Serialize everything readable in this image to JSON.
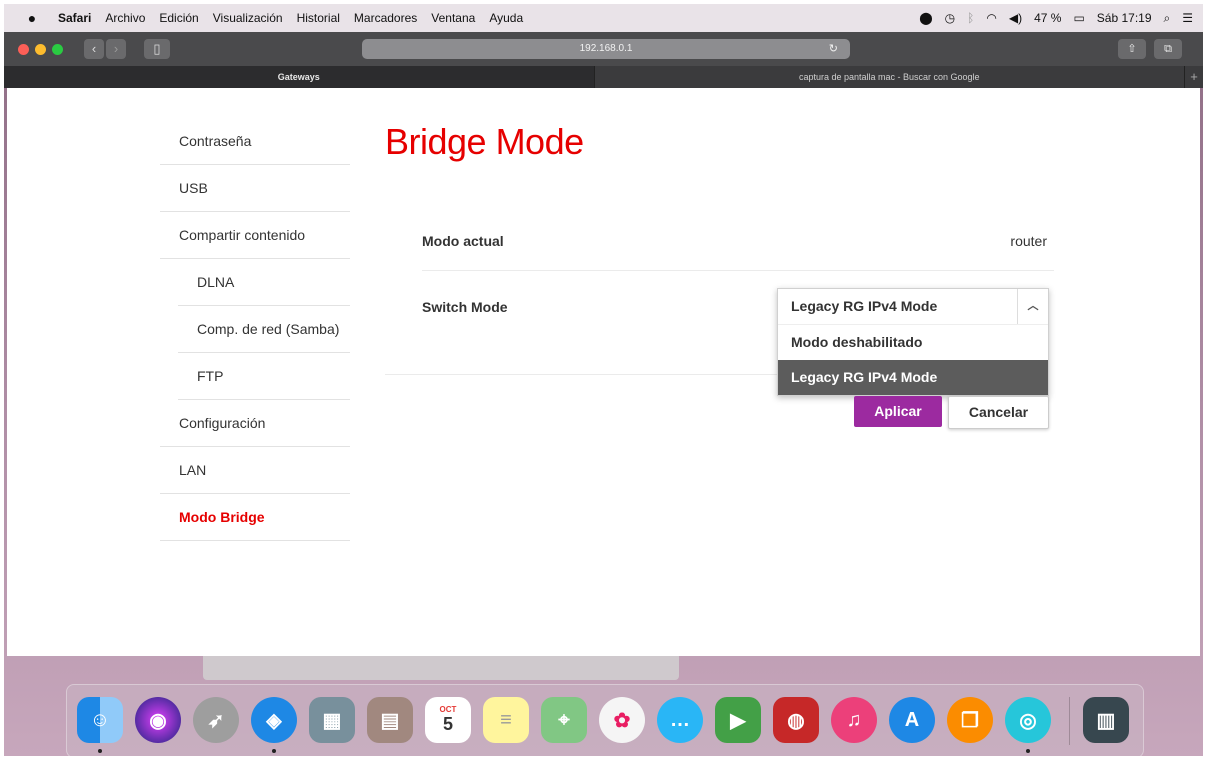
{
  "menubar": {
    "apple": "",
    "items": [
      "Safari",
      "Archivo",
      "Edición",
      "Visualización",
      "Historial",
      "Marcadores",
      "Ventana",
      "Ayuda"
    ],
    "battery": "47 %",
    "clock": "Sáb 17:19"
  },
  "toolbar": {
    "url": "192.168.0.1",
    "lights": [
      "#fc5f57",
      "#fdbc2e",
      "#2acb42"
    ]
  },
  "tabs": [
    {
      "label": "Gateways"
    },
    {
      "label": "captura de pantalla mac - Buscar con Google"
    }
  ],
  "sidebar": {
    "items": [
      {
        "label": "Contraseña"
      },
      {
        "label": "USB"
      },
      {
        "label": "Compartir contenido"
      },
      {
        "label": "DLNA"
      },
      {
        "label": "Comp. de red (Samba)"
      },
      {
        "label": "FTP"
      },
      {
        "label": "Configuración"
      },
      {
        "label": "LAN"
      },
      {
        "label": "Modo Bridge"
      }
    ]
  },
  "main": {
    "title": "Bridge Mode",
    "current_mode_label": "Modo actual",
    "current_mode_value": "router",
    "switch_mode_label": "Switch Mode",
    "dropdown": {
      "selected": "Legacy RG IPv4 Mode",
      "options": [
        "Modo deshabilitado",
        "Legacy RG IPv4 Mode"
      ]
    },
    "apply_label": "Aplicar",
    "cancel_label": "Cancelar"
  },
  "dock": {
    "calendar_month": "OCT",
    "calendar_day": "5"
  },
  "colors": {
    "brand": "#e60000",
    "apply": "#9c2aa0"
  }
}
